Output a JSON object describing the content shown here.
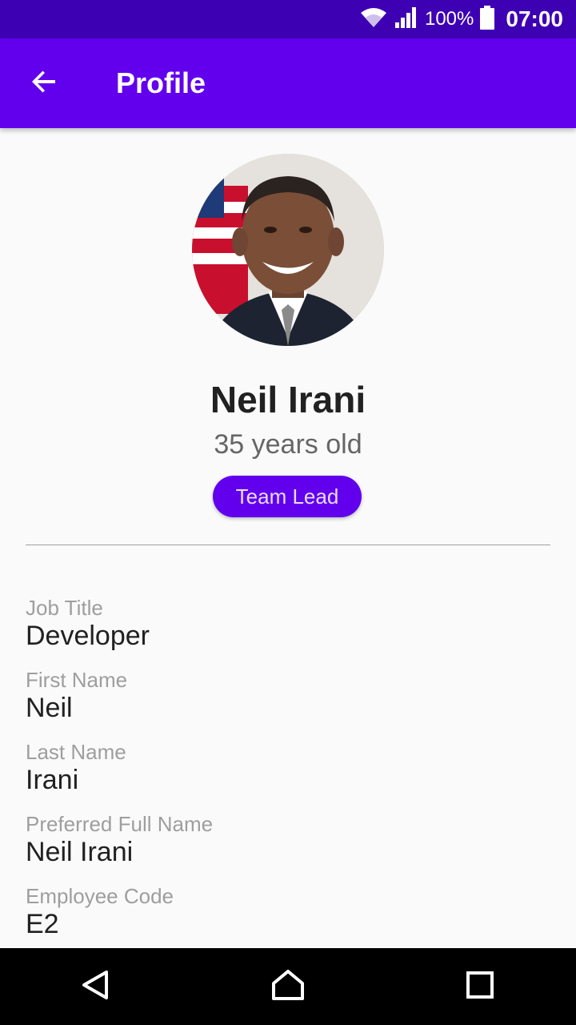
{
  "status_bar": {
    "battery_text": "100%",
    "time": "07:00",
    "icons": [
      "wifi-icon",
      "signal-icon",
      "battery-icon"
    ]
  },
  "app_bar": {
    "title": "Profile",
    "back_icon": "arrow-back-icon"
  },
  "profile": {
    "name": "Neil Irani",
    "age_text": "35 years old",
    "role_badge": "Team Lead"
  },
  "fields": [
    {
      "label": "Job Title",
      "value": "Developer"
    },
    {
      "label": "First Name",
      "value": "Neil"
    },
    {
      "label": "Last Name",
      "value": "Irani"
    },
    {
      "label": "Preferred Full Name",
      "value": "Neil Irani"
    },
    {
      "label": "Employee Code",
      "value": "E2"
    }
  ],
  "nav_bar": {
    "icons": [
      "back-triangle-icon",
      "home-icon",
      "recents-square-icon"
    ]
  },
  "colors": {
    "primary": "#6200ee",
    "status_bar": "#3e00b3",
    "background": "#fafafa"
  }
}
